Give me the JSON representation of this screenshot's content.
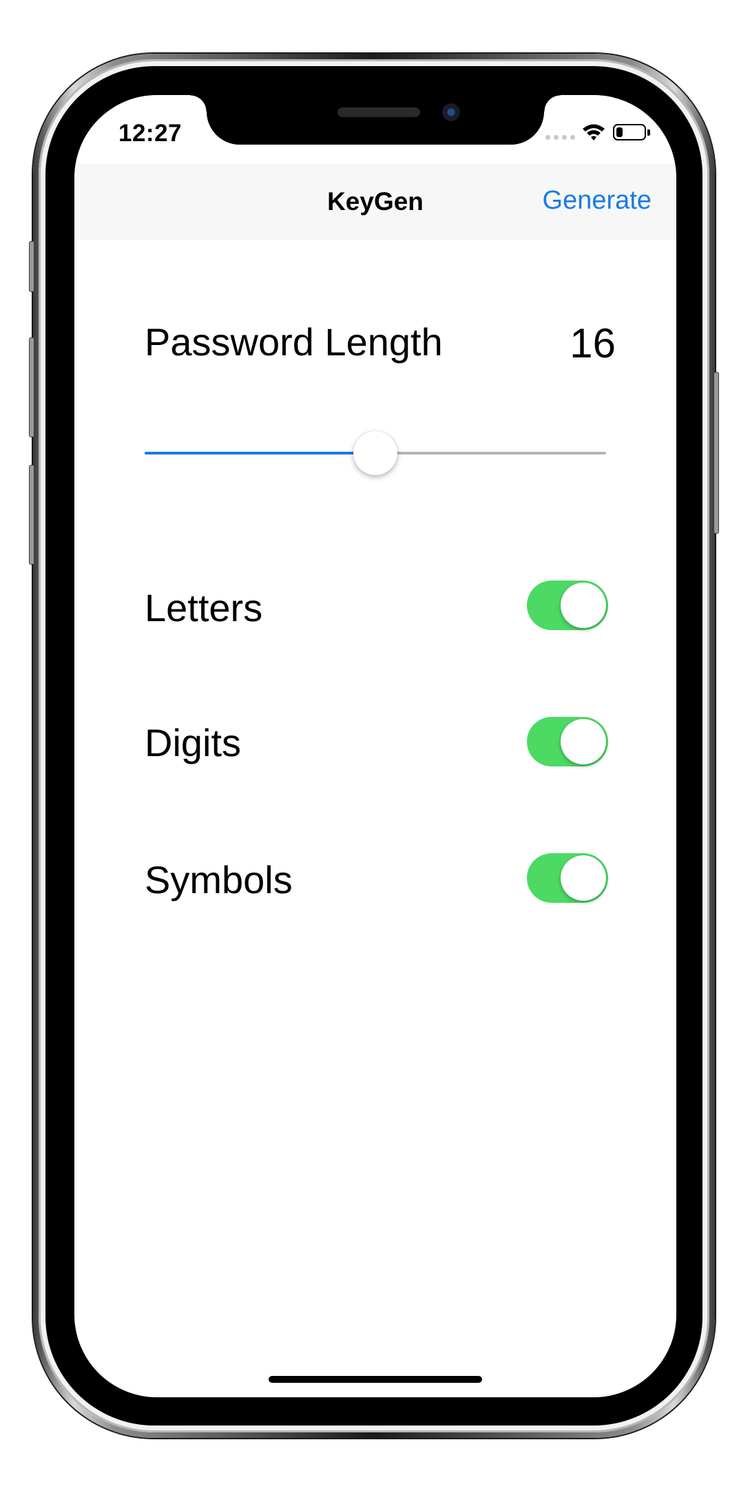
{
  "status_bar": {
    "time": "12:27",
    "battery_level": 0.35
  },
  "nav_bar": {
    "title": "KeyGen",
    "generate_label": "Generate"
  },
  "password_length": {
    "label": "Password Length",
    "value": "16",
    "slider_fraction": 0.5
  },
  "options": [
    {
      "label": "Letters",
      "enabled": true
    },
    {
      "label": "Digits",
      "enabled": true
    },
    {
      "label": "Symbols",
      "enabled": true
    }
  ],
  "colors": {
    "accent": "#1a7ae6",
    "toggle_on": "#4cd964",
    "nav_background": "#f7f7f7"
  }
}
